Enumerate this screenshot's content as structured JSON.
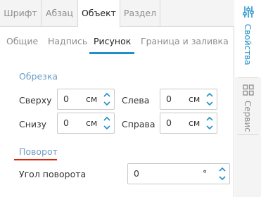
{
  "top_tabs": [
    "Шрифт",
    "Абзац",
    "Объект",
    "Раздел"
  ],
  "sub_tabs": [
    "Общие",
    "Надпись",
    "Рисунок",
    "Граница и заливка"
  ],
  "crop": {
    "title": "Обрезка",
    "top_label": "Сверху",
    "left_label": "Слева",
    "bottom_label": "Снизу",
    "right_label": "Справа",
    "top_value": "0",
    "left_value": "0",
    "bottom_value": "0",
    "right_value": "0",
    "unit": "см"
  },
  "rotation": {
    "title": "Поворот",
    "angle_label": "Угол поворота",
    "angle_value": "0",
    "angle_unit": "°"
  },
  "side_tabs": {
    "properties": "Свойства",
    "service": "Сервис"
  },
  "colors": {
    "accent": "#1f8ec9",
    "section_title": "#6b9dc2",
    "rotation_underline": "#d9230b"
  }
}
